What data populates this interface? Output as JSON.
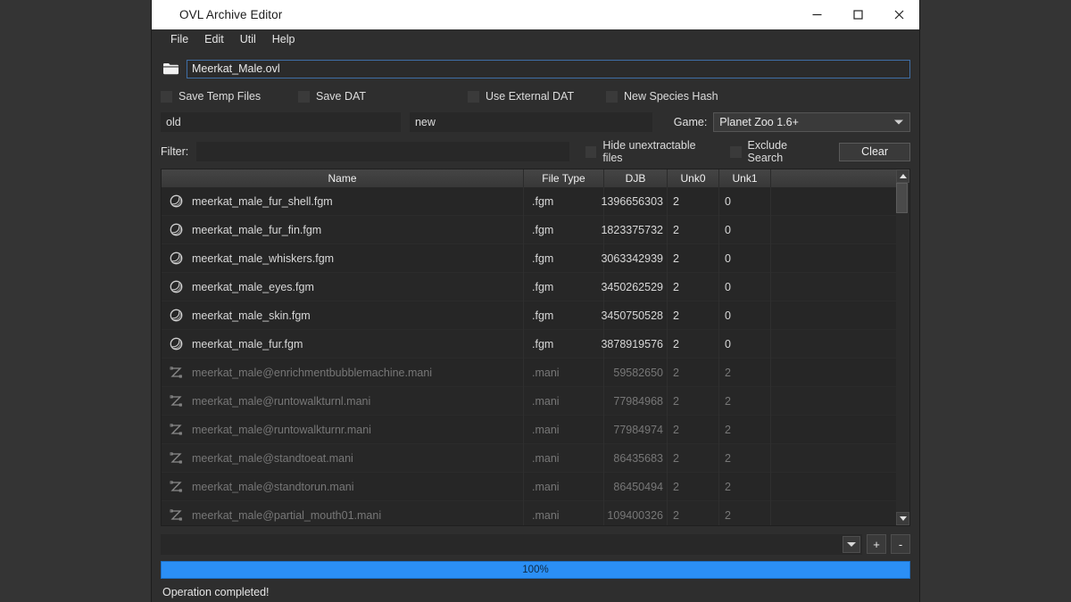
{
  "window": {
    "title": "OVL Archive Editor",
    "controls": {
      "minimize": "minimize-icon",
      "maximize": "maximize-icon",
      "close": "close-icon"
    }
  },
  "menubar": {
    "items": [
      "File",
      "Edit",
      "Util",
      "Help"
    ]
  },
  "file_row": {
    "folder_icon": "folder-icon",
    "path_value": "Meerkat_Male.ovl"
  },
  "options": {
    "save_temp_files": "Save Temp Files",
    "save_dat": "Save DAT",
    "use_external_dat": "Use External DAT",
    "new_species_hash": "New Species Hash"
  },
  "rename": {
    "old_value": "old",
    "new_value": "new"
  },
  "game": {
    "label": "Game:",
    "selected": "Planet Zoo 1.6+"
  },
  "filter": {
    "label": "Filter:",
    "value": "",
    "hide_unextractable": "Hide unextractable files",
    "exclude_search": "Exclude Search",
    "clear_button": "Clear"
  },
  "table": {
    "columns": [
      "Name",
      "File Type",
      "DJB",
      "Unk0",
      "Unk1"
    ],
    "rows": [
      {
        "icon": "sphere-icon",
        "name": "meerkat_male_fur_shell.fgm",
        "file_type": ".fgm",
        "djb": "1396656303",
        "unk0": "2",
        "unk1": "0",
        "dim": false
      },
      {
        "icon": "sphere-icon",
        "name": "meerkat_male_fur_fin.fgm",
        "file_type": ".fgm",
        "djb": "1823375732",
        "unk0": "2",
        "unk1": "0",
        "dim": false
      },
      {
        "icon": "sphere-icon",
        "name": "meerkat_male_whiskers.fgm",
        "file_type": ".fgm",
        "djb": "3063342939",
        "unk0": "2",
        "unk1": "0",
        "dim": false
      },
      {
        "icon": "sphere-icon",
        "name": "meerkat_male_eyes.fgm",
        "file_type": ".fgm",
        "djb": "3450262529",
        "unk0": "2",
        "unk1": "0",
        "dim": false
      },
      {
        "icon": "sphere-icon",
        "name": "meerkat_male_skin.fgm",
        "file_type": ".fgm",
        "djb": "3450750528",
        "unk0": "2",
        "unk1": "0",
        "dim": false
      },
      {
        "icon": "sphere-icon",
        "name": "meerkat_male_fur.fgm",
        "file_type": ".fgm",
        "djb": "3878919576",
        "unk0": "2",
        "unk1": "0",
        "dim": false
      },
      {
        "icon": "animation-curve-icon",
        "name": "meerkat_male@enrichmentbubblemachine.mani",
        "file_type": ".mani",
        "djb": "59582650",
        "unk0": "2",
        "unk1": "2",
        "dim": true
      },
      {
        "icon": "animation-curve-icon",
        "name": "meerkat_male@runtowalkturnl.mani",
        "file_type": ".mani",
        "djb": "77984968",
        "unk0": "2",
        "unk1": "2",
        "dim": true
      },
      {
        "icon": "animation-curve-icon",
        "name": "meerkat_male@runtowalkturnr.mani",
        "file_type": ".mani",
        "djb": "77984974",
        "unk0": "2",
        "unk1": "2",
        "dim": true
      },
      {
        "icon": "animation-curve-icon",
        "name": "meerkat_male@standtoeat.mani",
        "file_type": ".mani",
        "djb": "86435683",
        "unk0": "2",
        "unk1": "2",
        "dim": true
      },
      {
        "icon": "animation-curve-icon",
        "name": "meerkat_male@standtorun.mani",
        "file_type": ".mani",
        "djb": "86450494",
        "unk0": "2",
        "unk1": "2",
        "dim": true
      },
      {
        "icon": "animation-curve-icon",
        "name": "meerkat_male@partial_mouth01.mani",
        "file_type": ".mani",
        "djb": "109400326",
        "unk0": "2",
        "unk1": "2",
        "dim": true
      }
    ]
  },
  "bottom": {
    "combo_value": "",
    "add_button": "+",
    "remove_button": "-"
  },
  "progress": {
    "percent_label": "100%",
    "value": 100,
    "color": "#2b8ff5"
  },
  "status": {
    "text": "Operation completed!"
  }
}
